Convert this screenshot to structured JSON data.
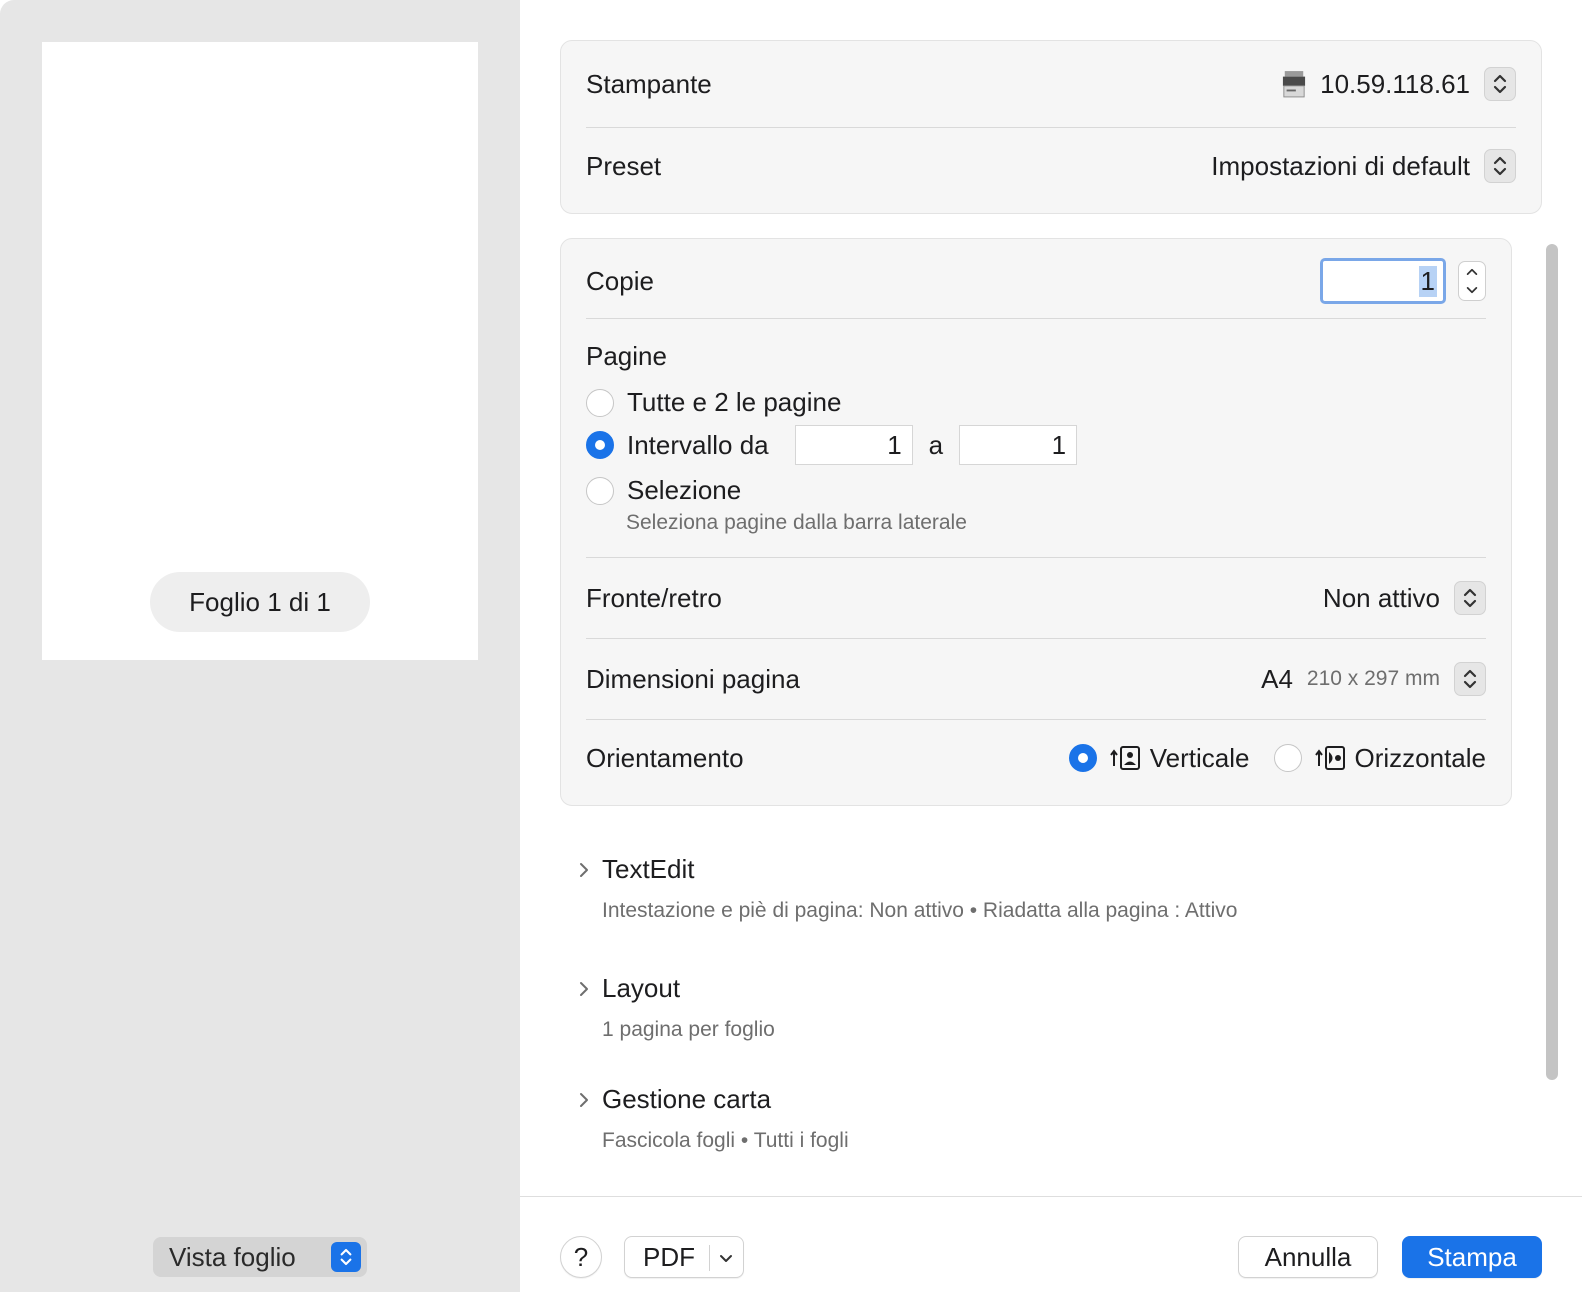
{
  "preview": {
    "sheet_label": "Foglio 1 di 1",
    "view_mode": "Vista foglio"
  },
  "printer": {
    "label": "Stampante",
    "value": "10.59.118.61"
  },
  "preset": {
    "label": "Preset",
    "value": "Impostazioni di default"
  },
  "copies": {
    "label": "Copie",
    "value": "1"
  },
  "pages": {
    "title": "Pagine",
    "all_label": "Tutte e 2 le pagine",
    "range_label": "Intervallo da",
    "range_from": "1",
    "range_to_label": "a",
    "range_to": "1",
    "selection_label": "Selezione",
    "selection_hint": "Seleziona pagine dalla barra laterale",
    "selected": "range"
  },
  "duplex": {
    "label": "Fronte/retro",
    "value": "Non attivo"
  },
  "paper_size": {
    "label": "Dimensioni pagina",
    "value": "A4",
    "dims": "210 x 297 mm"
  },
  "orientation": {
    "label": "Orientamento",
    "portrait_label": "Verticale",
    "landscape_label": "Orizzontale",
    "selected": "portrait"
  },
  "sections": [
    {
      "title": "TextEdit",
      "summary": "Intestazione e piè di pagina: Non attivo • Riadatta alla pagina : Attivo"
    },
    {
      "title": "Layout",
      "summary": "1 pagina per foglio"
    },
    {
      "title": "Gestione carta",
      "summary": "Fascicola fogli • Tutti i fogli"
    }
  ],
  "footer": {
    "help_label": "?",
    "pdf_label": "PDF",
    "cancel_label": "Annulla",
    "print_label": "Stampa"
  },
  "colors": {
    "accent": "#1a73e8",
    "pane_bg": "#e6e6e6",
    "panel_bg": "#f6f6f6"
  }
}
